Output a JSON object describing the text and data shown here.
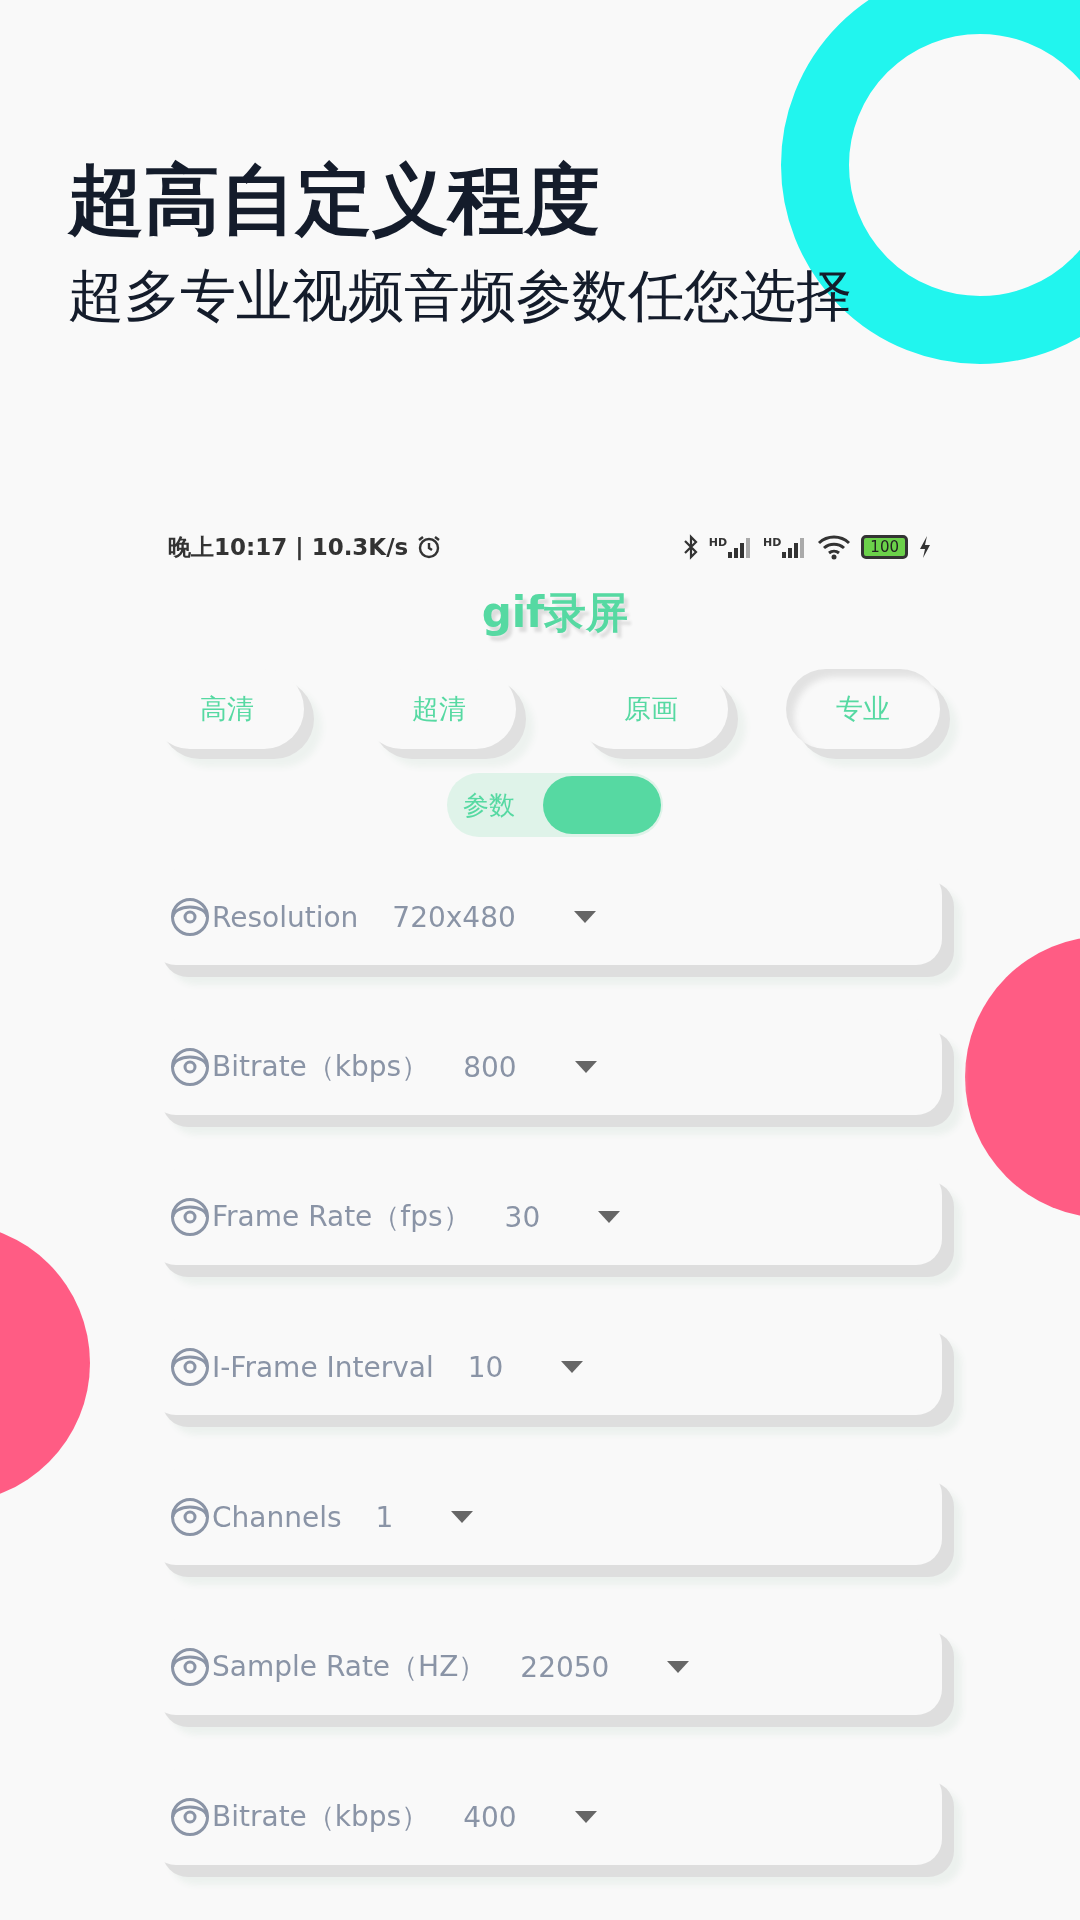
{
  "promo": {
    "headline": "超高自定义程度",
    "subheadline": "超多专业视频音频参数任您选择"
  },
  "status_bar": {
    "time": "晚上10:17 | 10.3K/s",
    "signal_labels": [
      "HD",
      "HD"
    ],
    "battery": "100"
  },
  "app_title": "gif录屏",
  "presets": [
    {
      "label": "高清",
      "selected": false
    },
    {
      "label": "超清",
      "selected": false
    },
    {
      "label": "原画",
      "selected": false
    },
    {
      "label": "专业",
      "selected": true
    }
  ],
  "params_toggle": {
    "label": "参数",
    "on": true
  },
  "settings": [
    {
      "label": "Resolution",
      "value": "720x480"
    },
    {
      "label": "Bitrate（kbps）",
      "value": "800"
    },
    {
      "label": "Frame Rate（fps）",
      "value": "30"
    },
    {
      "label": "I-Frame Interval",
      "value": "10"
    },
    {
      "label": "Channels",
      "value": "1"
    },
    {
      "label": "Sample Rate（HZ）",
      "value": "22050"
    },
    {
      "label": "Bitrate（kbps）",
      "value": "400"
    }
  ]
}
